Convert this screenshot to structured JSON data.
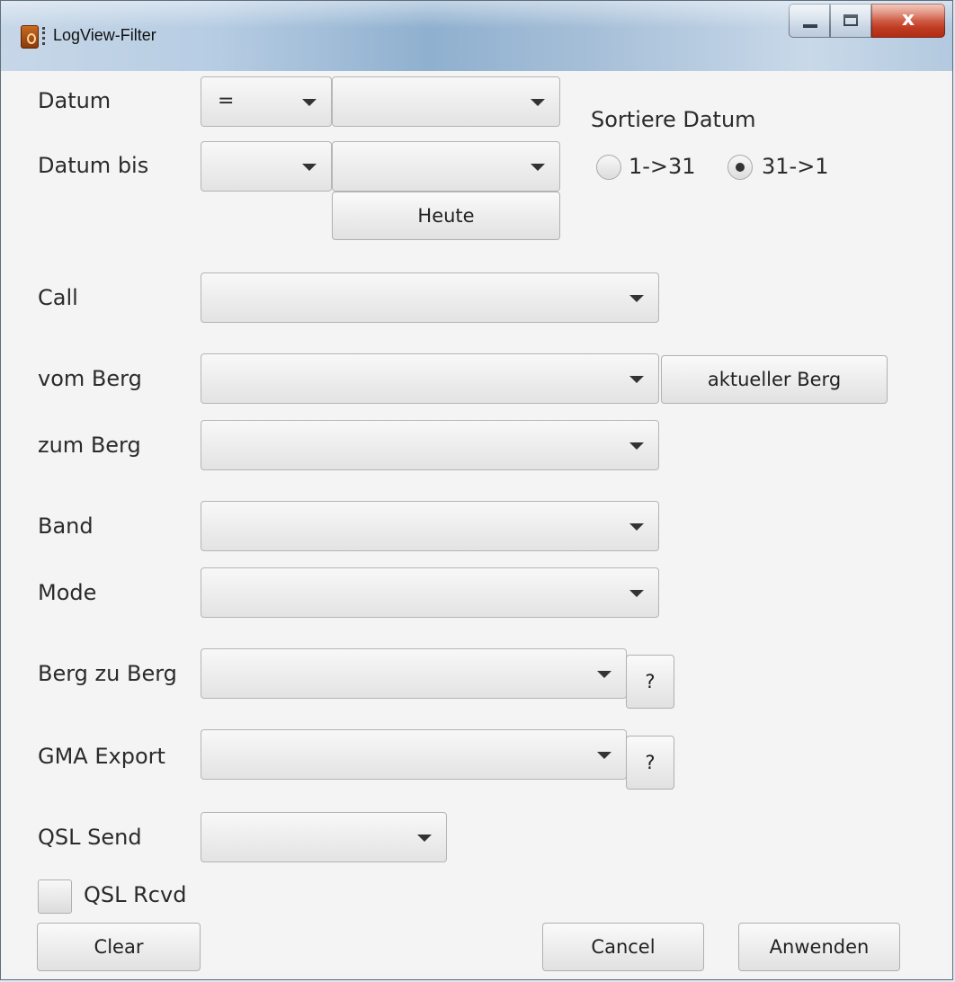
{
  "window": {
    "title": "LogView-Filter",
    "controls": {
      "close": "x"
    }
  },
  "datum": {
    "label": "Datum",
    "operator": "=",
    "value": ""
  },
  "datum_bis": {
    "label": "Datum bis",
    "operator": "",
    "value": ""
  },
  "heute_button": "Heute",
  "sort": {
    "label": "Sortiere Datum",
    "options": [
      {
        "label": "1->31",
        "selected": false
      },
      {
        "label": "31->1",
        "selected": true
      }
    ]
  },
  "call": {
    "label": "Call",
    "value": ""
  },
  "vom_berg": {
    "label": "vom Berg",
    "value": "",
    "button": "aktueller Berg"
  },
  "zum_berg": {
    "label": "zum Berg",
    "value": ""
  },
  "band": {
    "label": "Band",
    "value": ""
  },
  "mode": {
    "label": "Mode",
    "value": ""
  },
  "berg_zu_berg": {
    "label": "Berg zu Berg",
    "value": "",
    "help": "?"
  },
  "gma_export": {
    "label": "GMA Export",
    "value": "",
    "help": "?"
  },
  "qsl_send": {
    "label": "QSL Send",
    "value": ""
  },
  "qsl_rcvd": {
    "label": "QSL Rcvd",
    "checked": false
  },
  "footer": {
    "clear": "Clear",
    "cancel": "Cancel",
    "apply": "Anwenden"
  }
}
